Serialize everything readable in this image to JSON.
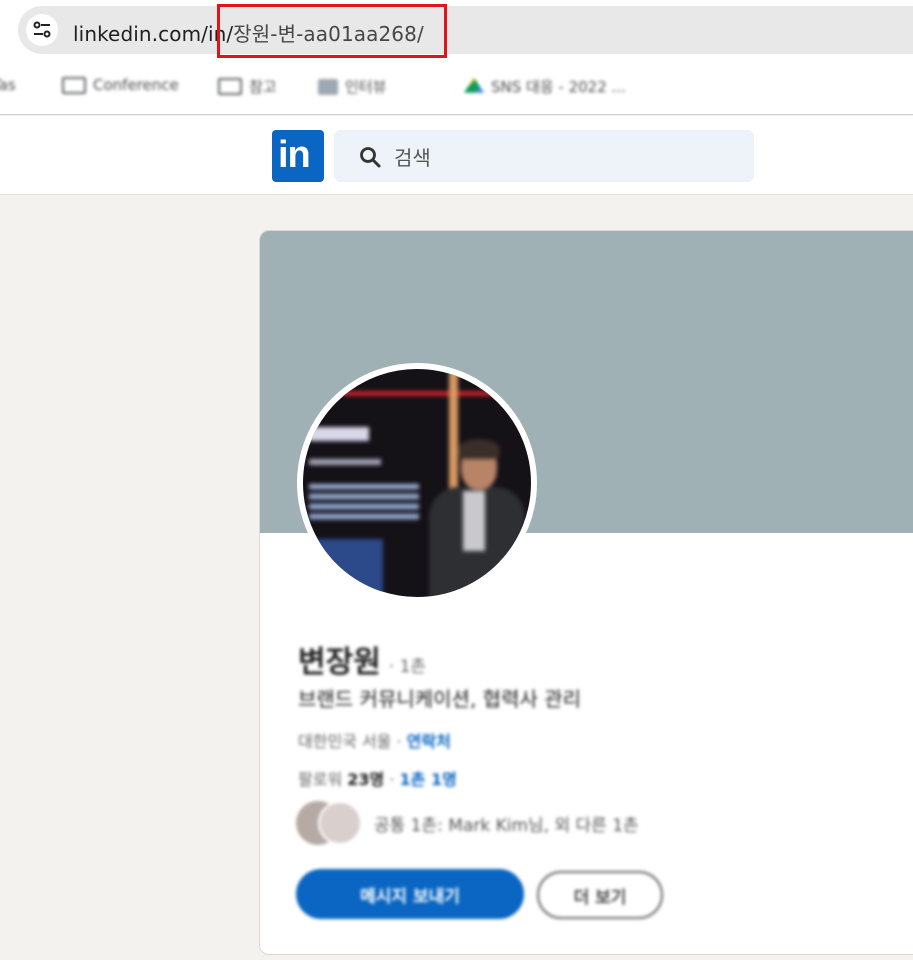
{
  "browser": {
    "url_host": "linkedin.com/in/",
    "url_path": "장원-변-aa01aa268/",
    "site_info_icon": "tune-icon"
  },
  "bookmarks": [
    {
      "label": "Tas",
      "icon": "folder-icon"
    },
    {
      "label": "Conference",
      "icon": "folder-icon"
    },
    {
      "label": "참고",
      "icon": "folder-icon"
    },
    {
      "label": "인터뷰",
      "icon": "linkedin-icon"
    },
    {
      "label": "SNS 대응 - 2022 ...",
      "icon": "drive-icon"
    }
  ],
  "linkedin_nav": {
    "logo_text": "in",
    "search_placeholder": "검색"
  },
  "profile": {
    "name": "변장원",
    "degree": "· 1촌",
    "headline": "브랜드 커뮤니케이션, 협력사 관리",
    "location": "대한민국 서울 · ",
    "contact_link": "연락처",
    "followers_prefix": "팔로워 ",
    "followers_count": "23명",
    "connections_link": "1촌 1명",
    "mutual_text": "공통 1촌: Mark Kim님, 외 다른 1촌",
    "message_button": "메시지 보내기",
    "more_button": "더 보기"
  },
  "colors": {
    "linkedin_blue": "#0a66c2",
    "banner": "#a0b1b6",
    "highlight_box": "#e2141b"
  }
}
